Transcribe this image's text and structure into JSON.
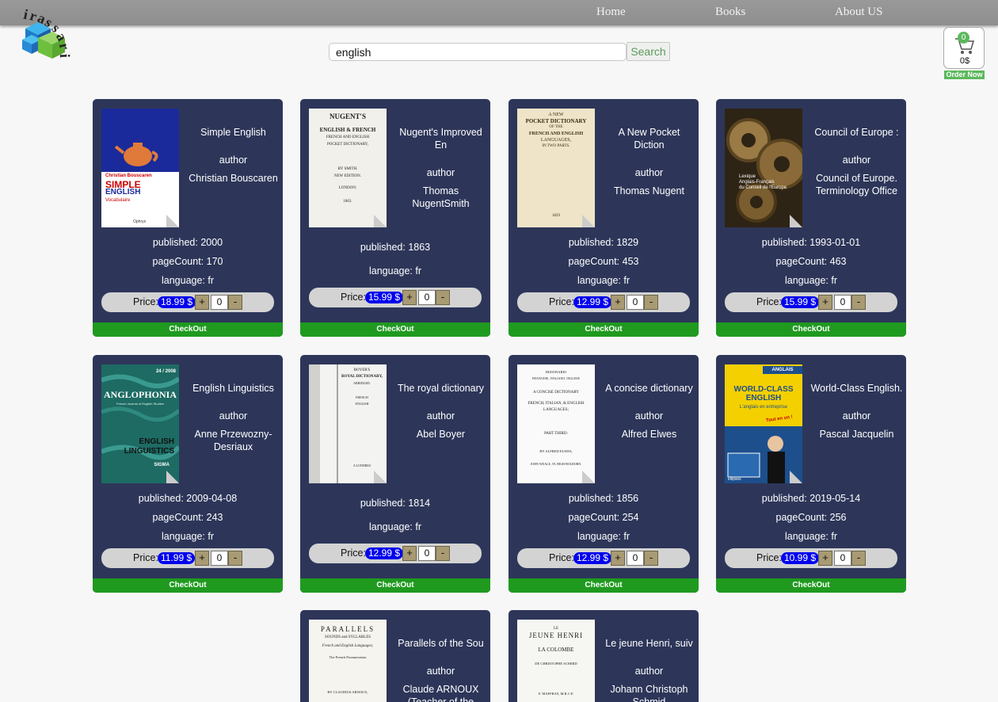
{
  "nav": {
    "home": "Home",
    "books": "Books",
    "about": "About US"
  },
  "logo": {
    "text": "irassari"
  },
  "search": {
    "value": "english",
    "button": "Search"
  },
  "cart": {
    "count": "0",
    "total": "0$",
    "order_now": "Order Now"
  },
  "labels": {
    "author": "author",
    "price": "Price:",
    "checkout": "CheckOut",
    "plus": "+",
    "minus": "-"
  },
  "books": [
    {
      "title": "Simple English",
      "author": "Christian Bouscaren",
      "published": "published: 2000",
      "pages": "pageCount: 170",
      "language": "language: fr",
      "price": "18.99 $",
      "qty": "0",
      "cover": {
        "lines": [
          "Christian Bouscaren",
          "SIMPLE",
          "ENGLISH",
          "Vocabulaire",
          "Ophrys"
        ]
      }
    },
    {
      "title": "Nugent's Improved En",
      "author": "Thomas NugentSmith",
      "published": "published: 1863",
      "pages": "",
      "language": "language: fr",
      "price": "15.99 $",
      "qty": "0",
      "cover": {
        "lines": [
          "NUGENT'S",
          "ENGLISH & FRENCH",
          "FRENCH AND ENGLISH",
          "POCKET DICTIONARY,",
          "BY SMITH.",
          "NEW EDITION.",
          "LONDON:",
          "1863."
        ]
      }
    },
    {
      "title": "A New Pocket Diction",
      "author": "Thomas Nugent",
      "published": "published: 1829",
      "pages": "pageCount: 453",
      "language": "language: fr",
      "price": "12.99 $",
      "qty": "0",
      "cover": {
        "lines": [
          "A NEW",
          "POCKET DICTIONARY",
          "OF THE",
          "FRENCH AND ENGLISH",
          "LANGUAGES,",
          "IN TWO PARTS.",
          "1829"
        ]
      }
    },
    {
      "title": "Council of Europe :",
      "author": "Council of Europe. Terminology Office",
      "published": "published: 1993-01-01",
      "pages": "pageCount: 463",
      "language": "language: fr",
      "price": "15.99 $",
      "qty": "0",
      "cover": {
        "lines": [
          "Lexique",
          "Anglais-Français",
          "du Conseil de l'Europe"
        ]
      }
    },
    {
      "title": "English Linguistics",
      "author": "Anne Przewozny-Desriaux",
      "published": "published: 2009-04-08",
      "pages": "pageCount: 243",
      "language": "language: fr",
      "price": "11.99 $",
      "qty": "0",
      "cover": {
        "lines": [
          "24 / 2008",
          "ANGLOPHONIA",
          "French Journal of English Studies",
          "ENGLISH",
          "LINGUISTICS",
          "SIGMA"
        ]
      }
    },
    {
      "title": "The royal dictionary",
      "author": "Abel Boyer",
      "published": "published: 1814",
      "pages": "",
      "language": "language: fr",
      "price": "12.99 $",
      "qty": "0",
      "cover": {
        "lines": [
          "BOYER'S",
          "ROYAL DICTIONARY,",
          "ABRIDGED.",
          "FRENCH",
          "ENGLISH",
          "A LONDRES"
        ]
      }
    },
    {
      "title": "A concise dictionary",
      "author": "Alfred Elwes",
      "published": "published: 1856",
      "pages": "pageCount: 254",
      "language": "language: fr",
      "price": "12.99 $",
      "qty": "0",
      "cover": {
        "lines": [
          "DIZIONARIO",
          "FRANCESE, ITALIANO, INGLESE",
          "A CONCISE DICTIONARY",
          "FRENCH, ITALIAN, & ENGLISH",
          "LANGUAGES;",
          "PART THIRD:",
          "BY ALFRED ELWES,",
          "JOHN WEALE, 59, HIGH HOLBORN."
        ]
      }
    },
    {
      "title": "World-Class English.",
      "author": "Pascal Jacquelin",
      "published": "published: 2019-05-14",
      "pages": "pageCount: 256",
      "language": "language: fr",
      "price": "10.99 $",
      "qty": "0",
      "cover": {
        "lines": [
          "ANGLAIS",
          "WORLD-CLASS",
          "ENGLISH",
          "L'anglais en entreprise",
          "Tout en un !",
          "ellipses"
        ]
      }
    },
    {
      "title": "Parallels of the Sou",
      "author": "Claude ARNOUX (Teacher of the",
      "published": "",
      "pages": "",
      "language": "",
      "price": "",
      "qty": "",
      "cover": {
        "lines": [
          "PARALLELS",
          "SOUNDS and SYLLABLES",
          "French and English Languages;",
          "The French Pronunciation",
          "BY CLAUDIUS ARNOUX,"
        ]
      }
    },
    {
      "title": "Le jeune Henri, suiv",
      "author": "Johann Christoph Schmid",
      "published": "",
      "pages": "",
      "language": "",
      "price": "",
      "qty": "",
      "cover": {
        "lines": [
          "LE",
          "JEUNE HENRI",
          "LA COLOMBE",
          "DE CHRISTOPHE SCHMID",
          "F. MAFFRAY, M.R.C.P."
        ]
      }
    }
  ],
  "colors": {
    "card": "#2d3659",
    "checkout": "#1f9a1f",
    "price_badge": "#0000ee",
    "topbar": "#929292"
  }
}
